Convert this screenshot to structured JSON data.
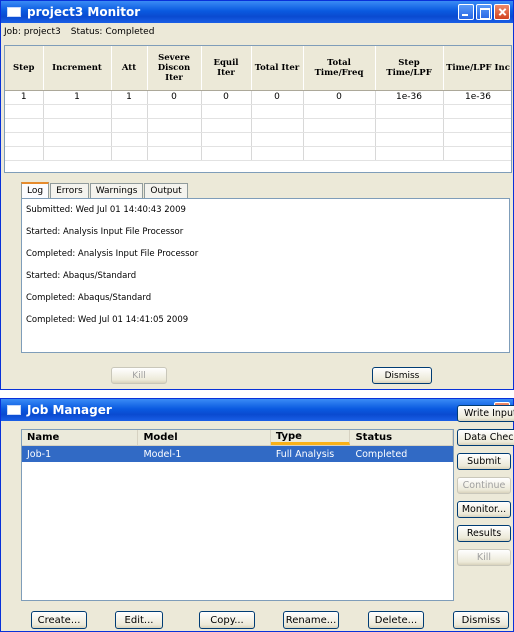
{
  "monitor": {
    "title": "project3 Monitor",
    "job_label": "Job:",
    "job_value": "project3",
    "status_label": "Status:",
    "status_value": "Completed",
    "columns": [
      "Step",
      "Increment",
      "Att",
      "Severe Discon Iter",
      "Equil Iter",
      "Total Iter",
      "Total Time/Freq",
      "Step Time/LPF",
      "Time/LPF Inc"
    ],
    "rows": [
      [
        "1",
        "1",
        "1",
        "0",
        "0",
        "0",
        "0",
        "1e-36",
        "1e-36"
      ]
    ],
    "tabs": [
      "Log",
      "Errors",
      "Warnings",
      "Output"
    ],
    "active_tab": "Log",
    "log_lines": [
      "Submitted: Wed Jul 01 14:40:43 2009",
      "Started:   Analysis Input File Processor",
      "Completed: Analysis Input File Processor",
      "Started:   Abaqus/Standard",
      "Completed: Abaqus/Standard",
      "Completed: Wed Jul 01 14:41:05 2009"
    ],
    "kill_label": "Kill",
    "dismiss_label": "Dismiss"
  },
  "job_manager": {
    "title": "Job Manager",
    "columns": [
      "Name",
      "Model",
      "Type",
      "Status"
    ],
    "rows": [
      {
        "name": "Job-1",
        "model": "Model-1",
        "type": "Full Analysis",
        "status": "Completed"
      }
    ],
    "side_buttons": [
      "Write Input",
      "Data Check",
      "Submit",
      "Continue",
      "Monitor...",
      "Results",
      "Kill"
    ],
    "bottom_buttons": [
      "Create...",
      "Edit...",
      "Copy...",
      "Rename...",
      "Delete...",
      "Dismiss"
    ]
  },
  "icons": {
    "window_icon": "window-icon",
    "minimize": "minimize-icon",
    "maximize": "maximize-icon",
    "close": "close-icon"
  },
  "colors": {
    "titlebar": "#0a5ae0",
    "selection": "#316ac5",
    "tab_highlight": "#e68b2c",
    "sort_indicator": "#f9b119"
  }
}
